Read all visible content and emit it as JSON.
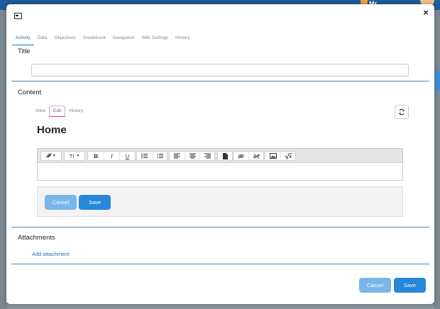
{
  "background": {
    "user_initial": "Mr"
  },
  "modal": {
    "tabs": [
      {
        "label": "Activity",
        "active": true
      },
      {
        "label": "Data",
        "active": false
      },
      {
        "label": "Objectives",
        "active": false
      },
      {
        "label": "Gradebook",
        "active": false
      },
      {
        "label": "Navigation",
        "active": false
      },
      {
        "label": "Wiki Settings",
        "active": false
      },
      {
        "label": "History",
        "active": false
      }
    ],
    "close_label": "×",
    "title_section": {
      "label": "Title",
      "input_value": "",
      "placeholder": ""
    },
    "content_section": {
      "label": "Content",
      "view_tabs": [
        {
          "label": "View",
          "active": false
        },
        {
          "label": "Edit",
          "active": true
        },
        {
          "label": "History",
          "active": false
        }
      ],
      "page_heading": "Home",
      "toolbar": {
        "font_label": "𝓕",
        "size_label": "TI",
        "bold": "B",
        "italic": "I",
        "underline": "U"
      },
      "cancel_label": "Cancel",
      "save_label": "Save"
    },
    "attachments_section": {
      "label": "Attachments",
      "add_link": "Add attachment"
    },
    "footer": {
      "cancel_label": "Cancel",
      "save_label": "Save"
    }
  },
  "colors": {
    "accent": "#2787d9",
    "accent_light": "#79b6e9",
    "divider": "#3e8bc9",
    "edit_tab": "#b43ab4"
  }
}
